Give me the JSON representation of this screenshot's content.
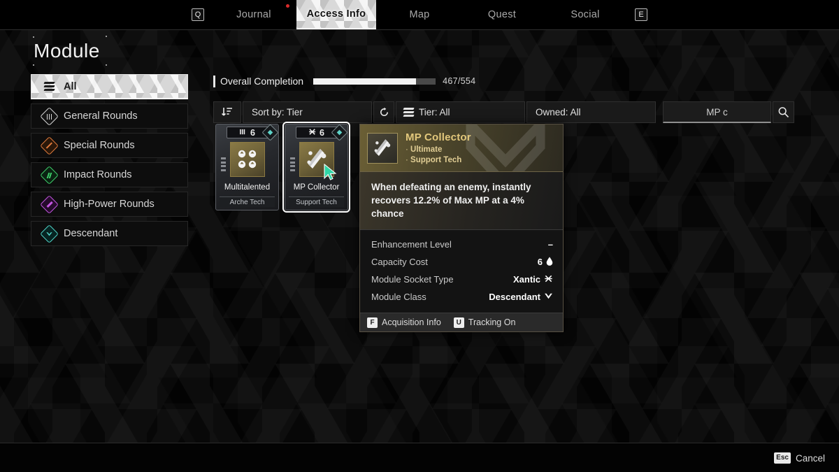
{
  "topbar": {
    "left_key": "Q",
    "right_key": "E",
    "tabs": [
      {
        "label": "Journal",
        "active": false
      },
      {
        "label": "Access Info",
        "active": true
      },
      {
        "label": "Map",
        "active": false
      },
      {
        "label": "Quest",
        "active": false
      },
      {
        "label": "Social",
        "active": false
      }
    ]
  },
  "page": {
    "title": "Module"
  },
  "sidebar": {
    "items": [
      {
        "label": "All",
        "icon": "stack-icon",
        "color": "#1a1a1a",
        "active": true
      },
      {
        "label": "General Rounds",
        "icon": "general-rounds-icon",
        "color": "#d8d8d8",
        "active": false
      },
      {
        "label": "Special Rounds",
        "icon": "special-rounds-icon",
        "color": "#e07a3c",
        "active": false
      },
      {
        "label": "Impact Rounds",
        "icon": "impact-rounds-icon",
        "color": "#3fcf6a",
        "active": false
      },
      {
        "label": "High-Power Rounds",
        "icon": "high-power-rounds-icon",
        "color": "#c356e0",
        "active": false
      },
      {
        "label": "Descendant",
        "icon": "descendant-icon",
        "color": "#4fd4c8",
        "active": false
      }
    ]
  },
  "completion": {
    "label": "Overall Completion",
    "count": "467/554",
    "current": 467,
    "total": 554,
    "percent": 84
  },
  "filters": {
    "sort": "Sort by: Tier",
    "refresh_icon": "refresh-icon",
    "sort_icon": "sort-icon",
    "tier": "Tier: All",
    "owned": "Owned: All",
    "search_value": "MP c",
    "search_placeholder": "Search",
    "search_icon": "search-icon"
  },
  "cards": [
    {
      "name": "Multitalented",
      "tech": "Arche Tech",
      "cost": "6",
      "socket_icon": "almandine-socket-icon",
      "tier_icon": "descendant-badge-icon",
      "selected": false
    },
    {
      "name": "MP Collector",
      "tech": "Support Tech",
      "cost": "6",
      "socket_icon": "xantic-socket-icon",
      "tier_icon": "descendant-badge-icon",
      "selected": true
    }
  ],
  "detail": {
    "title": "MP Collector",
    "tags": [
      "Ultimate",
      "Support Tech"
    ],
    "description": "When defeating an enemy, instantly recovers 12.2% of Max MP at a 4% chance",
    "stats": [
      {
        "key": "Enhancement Level",
        "value": "–",
        "icon": ""
      },
      {
        "key": "Capacity Cost",
        "value": "6",
        "icon": "capacity-drop-icon"
      },
      {
        "key": "Module Socket Type",
        "value": "Xantic",
        "icon": "xantic-socket-icon"
      },
      {
        "key": "Module Class",
        "value": "Descendant",
        "icon": "descendant-class-icon"
      }
    ],
    "footer": [
      {
        "key": "F",
        "label": "Acquisition Info"
      },
      {
        "key": "U",
        "label": "Tracking On"
      }
    ]
  },
  "bottom": {
    "cancel_key": "Esc",
    "cancel_label": "Cancel"
  }
}
